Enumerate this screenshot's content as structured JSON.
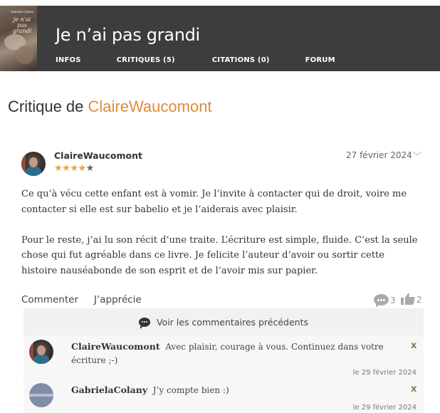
{
  "book": {
    "cover": {
      "author": "Gabriela Colany",
      "title": "je n'ai pas grandi"
    },
    "title": "Je n’ai pas grandi",
    "tabs": [
      {
        "label": "INFOS"
      },
      {
        "label": "CRITIQUES (5)"
      },
      {
        "label": "CITATIONS (0)"
      },
      {
        "label": "FORUM"
      }
    ]
  },
  "page": {
    "title_prefix": "Critique de",
    "title_user": "ClaireWaucomont"
  },
  "review": {
    "author": "ClaireWaucomont",
    "rating": 4,
    "rating_max": 5,
    "date": "27 février 2024",
    "paragraphs": [
      "Ce qu’à vécu cette enfant est à vomir. Je l’invite à contacter qui de droit, voire me contacter si elle est sur babelio et je l’aiderais avec plaisir.",
      "Pour le reste, j’ai lu son récit d’une traite. L’écriture est simple, fluide. C’est la seule chose qui fut agréable dans ce livre. Je felicite l’auteur d’avoir ou sortir cette histoire nauséabonde de son esprit et de l’avoir mis sur papier."
    ],
    "actions": {
      "comment_label": "Commenter",
      "like_label": "J’apprécie",
      "comment_count": "3",
      "like_count": "2"
    }
  },
  "comments": {
    "previous_label": "Voir les commentaires précédents",
    "items": [
      {
        "author": "ClaireWaucomont",
        "text": "Avec plaisir, courage à vous. Continuez dans votre écriture ;-)",
        "date": "le 29 février 2024",
        "close": "x"
      },
      {
        "author": "GabrielaColany",
        "text": "J’y compte bien :)",
        "date": "le 29 février 2024",
        "close": "x"
      }
    ]
  },
  "colors": {
    "header_bg": "#3d3d3d",
    "accent": "#e08a3c",
    "star": "#f0a33a"
  }
}
